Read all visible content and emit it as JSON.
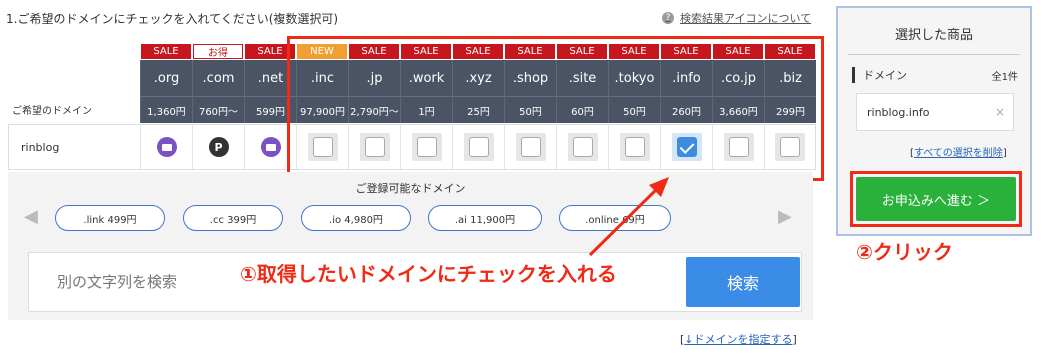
{
  "header": {
    "title": "1.ご希望のドメインにチェックを入れてください(複数選択可)",
    "help_link": "検索結果アイコンについて",
    "help_icon": "?"
  },
  "table": {
    "price_row_label": "ご希望のドメイン",
    "tlds": [
      {
        "badge": "SALE",
        "badge_type": "sale",
        "tld": ".org",
        "price": "1,360円",
        "status": "mail"
      },
      {
        "badge": "お得",
        "badge_type": "otoku",
        "tld": ".com",
        "price": "760円〜",
        "status": "p"
      },
      {
        "badge": "SALE",
        "badge_type": "sale",
        "tld": ".net",
        "price": "599円",
        "status": "mail"
      },
      {
        "badge": "NEW",
        "badge_type": "new",
        "tld": ".inc",
        "price": "97,900円",
        "status": "unchecked"
      },
      {
        "badge": "SALE",
        "badge_type": "sale",
        "tld": ".jp",
        "price": "2,790円〜",
        "status": "unchecked"
      },
      {
        "badge": "SALE",
        "badge_type": "sale",
        "tld": ".work",
        "price": "1円",
        "status": "unchecked"
      },
      {
        "badge": "SALE",
        "badge_type": "sale",
        "tld": ".xyz",
        "price": "25円",
        "status": "unchecked"
      },
      {
        "badge": "SALE",
        "badge_type": "sale",
        "tld": ".shop",
        "price": "50円",
        "status": "unchecked"
      },
      {
        "badge": "SALE",
        "badge_type": "sale",
        "tld": ".site",
        "price": "60円",
        "status": "unchecked"
      },
      {
        "badge": "SALE",
        "badge_type": "sale",
        "tld": ".tokyo",
        "price": "50円",
        "status": "unchecked"
      },
      {
        "badge": "SALE",
        "badge_type": "sale",
        "tld": ".info",
        "price": "260円",
        "status": "checked"
      },
      {
        "badge": "SALE",
        "badge_type": "sale",
        "tld": ".co.jp",
        "price": "3,660円",
        "status": "unchecked"
      },
      {
        "badge": "SALE",
        "badge_type": "sale",
        "tld": ".biz",
        "price": "299円",
        "status": "unchecked"
      }
    ],
    "row_name": "rinblog"
  },
  "suggestions": {
    "title": "ご登録可能なドメイン",
    "prev": "◀",
    "next": "▶",
    "items": [
      ".link 499円",
      ".cc 399円",
      ".io 4,980円",
      ".ai 11,900円",
      ".online 69円"
    ]
  },
  "search": {
    "placeholder": "別の文字列を検索",
    "button": "検索"
  },
  "annotations": {
    "step1": "①取得したいドメインにチェックを入れる",
    "step2": "②クリック"
  },
  "specify_link": {
    "prefix": "[",
    "text": "↓ドメインを指定する",
    "suffix": "]"
  },
  "panel": {
    "title": "選択した商品",
    "domain_label": "ドメイン",
    "count": "全1件",
    "selected": "rinblog.info",
    "remove_icon": "×",
    "clear_prefix": "[",
    "clear_text": "すべての選択を削除",
    "clear_suffix": "]",
    "apply": "お申込みへ進む ＞"
  },
  "colors": {
    "sale": "#c7161d",
    "new": "#f0a030",
    "header_bg": "#4a5465",
    "highlight": "#f02a14",
    "apply": "#29b13b",
    "search": "#3b8ce6"
  }
}
